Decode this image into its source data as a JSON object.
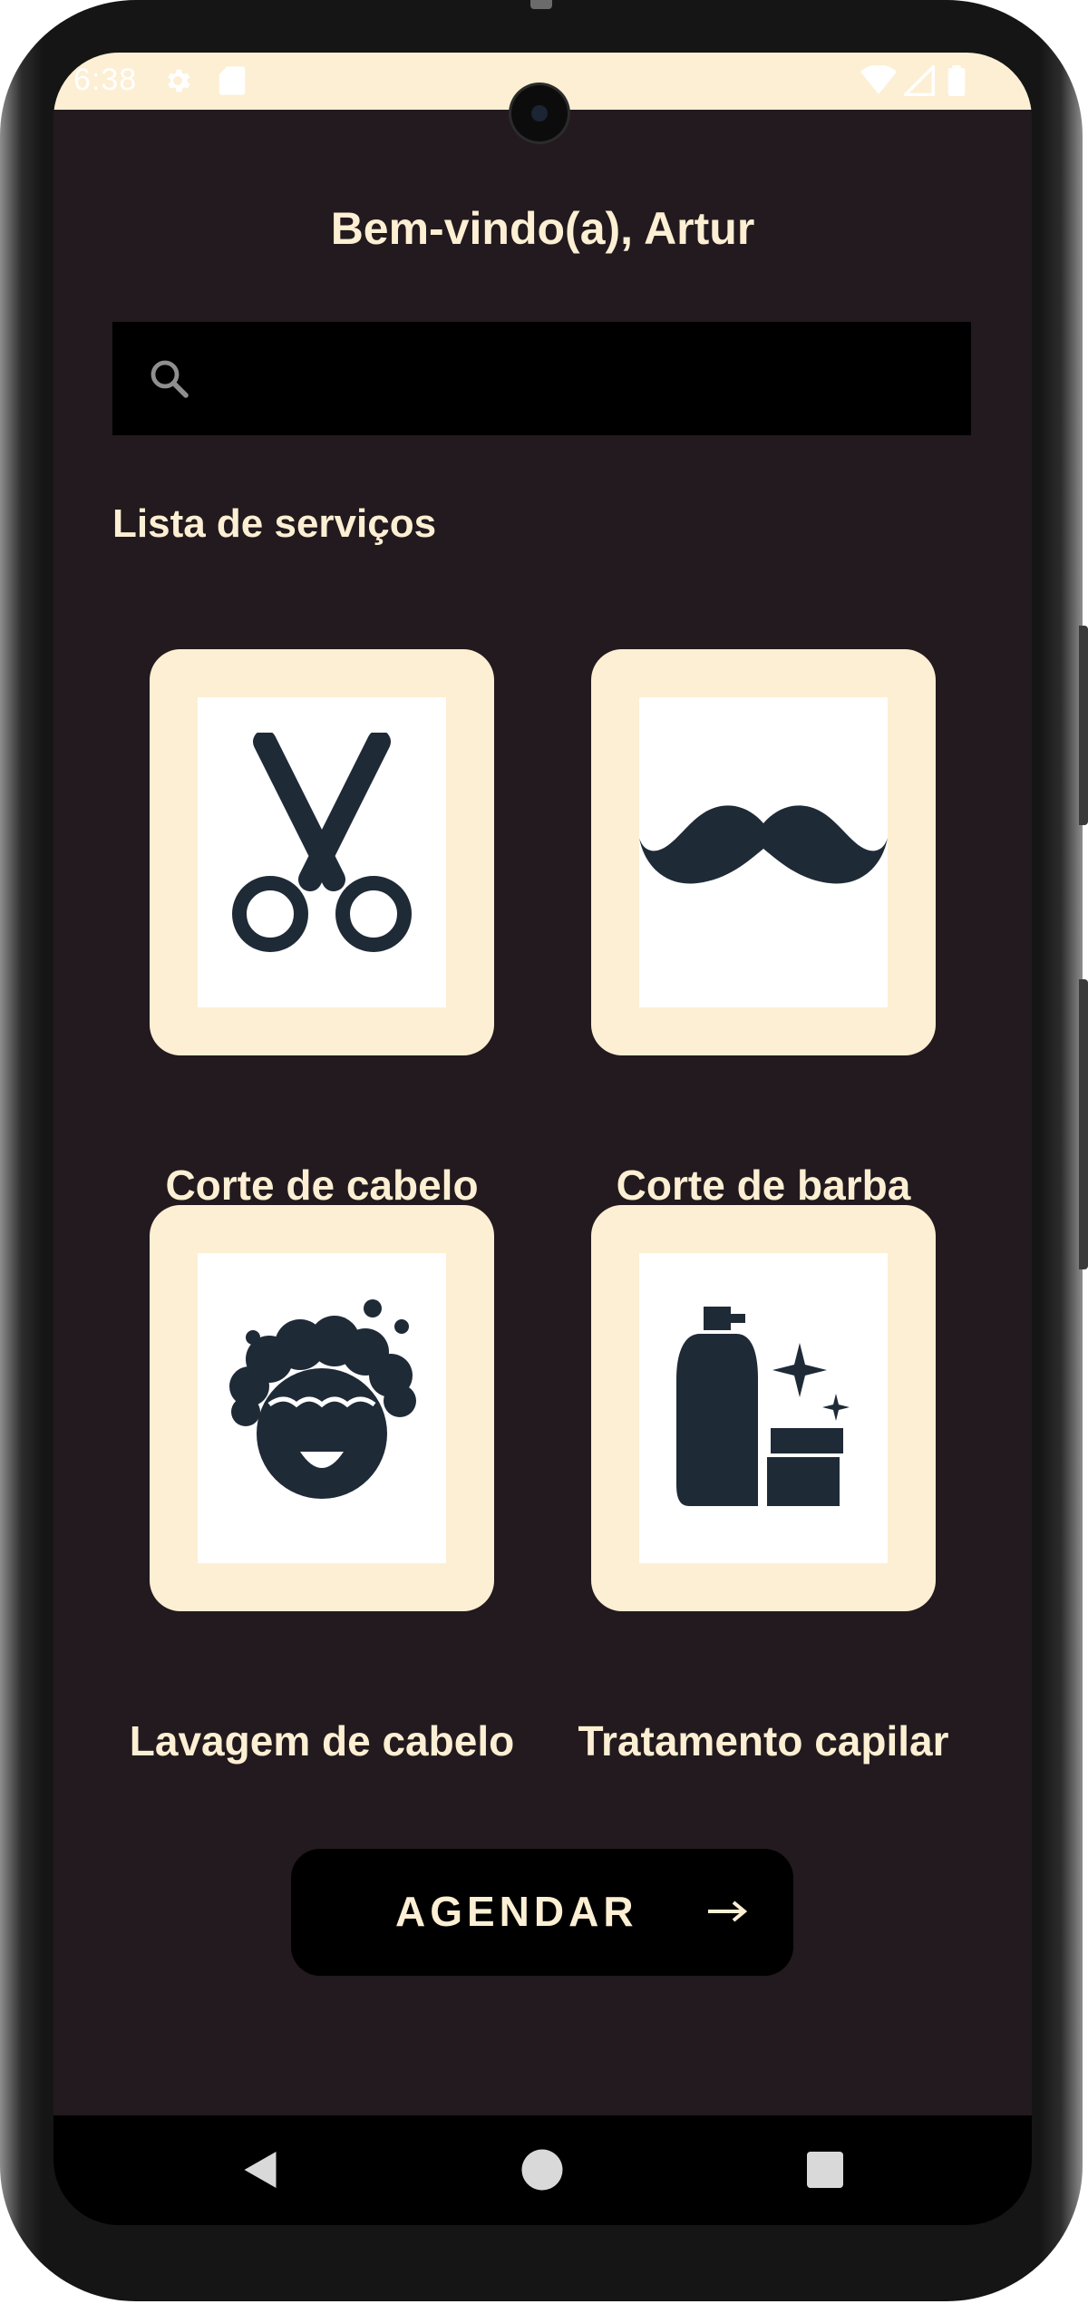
{
  "status_bar": {
    "time": "6:38",
    "icons": [
      "settings-icon",
      "sd-card-icon",
      "wifi-icon",
      "signal-icon",
      "battery-icon"
    ]
  },
  "header": {
    "greeting": "Bem-vindo(a), Artur"
  },
  "search": {
    "placeholder": "",
    "value": "",
    "icon": "search-icon"
  },
  "services": {
    "title": "Lista de serviços",
    "items": [
      {
        "label": "Corte de cabelo",
        "icon": "scissors-icon"
      },
      {
        "label": "Corte de barba",
        "icon": "mustache-icon"
      },
      {
        "label": "Lavagem de cabelo",
        "icon": "hair-wash-icon"
      },
      {
        "label": "Tratamento capilar",
        "icon": "hair-treatment-icon"
      }
    ]
  },
  "actions": {
    "schedule_label": "AGENDAR",
    "schedule_icon": "arrow-right-icon"
  },
  "nav_bar": {
    "icons": [
      "back-icon",
      "home-icon",
      "recents-icon"
    ]
  },
  "colors": {
    "background": "#221a1e",
    "accent": "#fdefd3",
    "icon_dark": "#1f2a37",
    "search_bg": "#000000"
  }
}
